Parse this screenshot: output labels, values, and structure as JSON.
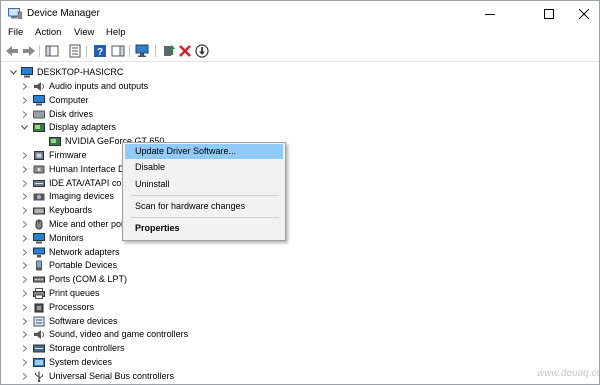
{
  "window": {
    "title": "Device Manager",
    "controls": [
      "minimize-icon",
      "maximize-icon",
      "close-icon"
    ]
  },
  "menubar": {
    "items": [
      "File",
      "Action",
      "View",
      "Help"
    ]
  },
  "toolbar": {
    "buttons": [
      "back-arrow-icon",
      "forward-arrow-icon",
      "show-hide-console-tree-icon",
      "properties-icon",
      "help-icon",
      "action-pane-icon",
      "monitor-icon",
      "update-driver-icon",
      "uninstall-icon",
      "disable-icon"
    ]
  },
  "tree": {
    "root": "DESKTOP-HASICRC",
    "items": [
      {
        "label": "Audio inputs and outputs",
        "icon": "speaker-icon",
        "expanded": false
      },
      {
        "label": "Computer",
        "icon": "computer-icon",
        "expanded": false
      },
      {
        "label": "Disk drives",
        "icon": "disk-icon",
        "expanded": false
      },
      {
        "label": "Display adapters",
        "icon": "display-adapter-icon",
        "expanded": true
      },
      {
        "label": "NVIDIA GeForce GT 650",
        "icon": "display-adapter-icon",
        "child": true
      },
      {
        "label": "Firmware",
        "icon": "firmware-icon",
        "expanded": false
      },
      {
        "label": "Human Interface Devices",
        "icon": "hid-icon",
        "expanded": false
      },
      {
        "label": "IDE ATA/ATAPI controllers",
        "icon": "ide-icon",
        "expanded": false
      },
      {
        "label": "Imaging devices",
        "icon": "camera-icon",
        "expanded": false
      },
      {
        "label": "Keyboards",
        "icon": "keyboard-icon",
        "expanded": false
      },
      {
        "label": "Mice and other pointing devices",
        "icon": "mouse-icon",
        "expanded": false
      },
      {
        "label": "Monitors",
        "icon": "monitor-icon",
        "expanded": false
      },
      {
        "label": "Network adapters",
        "icon": "network-icon",
        "expanded": false
      },
      {
        "label": "Portable Devices",
        "icon": "portable-device-icon",
        "expanded": false
      },
      {
        "label": "Ports (COM & LPT)",
        "icon": "port-icon",
        "expanded": false
      },
      {
        "label": "Print queues",
        "icon": "printer-icon",
        "expanded": false
      },
      {
        "label": "Processors",
        "icon": "processor-icon",
        "expanded": false
      },
      {
        "label": "Software devices",
        "icon": "software-device-icon",
        "expanded": false
      },
      {
        "label": "Sound, video and game controllers",
        "icon": "sound-icon",
        "expanded": false
      },
      {
        "label": "Storage controllers",
        "icon": "storage-icon",
        "expanded": false
      },
      {
        "label": "System devices",
        "icon": "system-icon",
        "expanded": false
      },
      {
        "label": "Universal Serial Bus controllers",
        "icon": "usb-icon",
        "expanded": false
      }
    ]
  },
  "context_menu": {
    "items": [
      {
        "label": "Update Driver Software...",
        "highlighted": true,
        "bold": false
      },
      {
        "label": "Disable",
        "highlighted": false,
        "bold": false
      },
      {
        "label": "Uninstall",
        "highlighted": false,
        "bold": false
      },
      {
        "separator": true
      },
      {
        "label": "Scan for hardware changes",
        "highlighted": false,
        "bold": false
      },
      {
        "separator": true
      },
      {
        "label": "Properties",
        "highlighted": false,
        "bold": true
      }
    ]
  },
  "watermark": "www.deuaq.com",
  "colors": {
    "highlight": "#91c9f7",
    "menu_bg": "#f2f2f2",
    "window_border": "#9aa0a6",
    "uninstall_red": "#d1232a",
    "update_green": "#2b8a3e"
  }
}
